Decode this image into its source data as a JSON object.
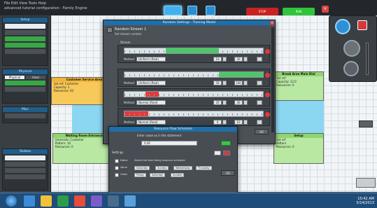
{
  "window": {
    "title_line1": "File  Edit  View  Tools  Help",
    "title_line2": "advanced  tutorial configuration - Family Engine"
  },
  "topbar": {
    "stop_label": "STOP",
    "run_label": "RUN"
  },
  "left_sidebar": {
    "sections": [
      {
        "title": "Setup"
      },
      {
        "title": "Physical"
      },
      {
        "title": "Misc"
      },
      {
        "title": "Toolbox"
      }
    ],
    "physical_tabs": [
      "Physical",
      "Ideal"
    ]
  },
  "canvas": {
    "cards": [
      {
        "title": "Customer Service Area",
        "lines": [
          "Set ref: Customer",
          "Capacity: 1",
          "Resources: 42"
        ]
      },
      {
        "title": "Waiting Room Entrance",
        "lines": [
          "Generate: Customer",
          "Pattern: 10",
          "Resources: 0"
        ]
      },
      {
        "title": "Break Area Main Dial",
        "lines": [
          "Set ref",
          "Capacity: 12.0",
          "Resources: 0"
        ]
      },
      {
        "title": "Setup",
        "lines": [
          "Set ref",
          "Pattern",
          "Resources: 0"
        ]
      }
    ]
  },
  "settings_dialog": {
    "title": "Random Settings - Training Model",
    "heading": "Random Stream 1",
    "subheading": "Set stream number",
    "section_label": "Stream",
    "rows": [
      {
        "mode_label": "Method",
        "mode_value": "Uniform (Real)",
        "min": "10",
        "max": "50",
        "fill_color": "#49c964",
        "fill_start": 0.3,
        "fill_end": 0.68
      },
      {
        "mode_label": "Method",
        "mode_value": "Uniform (Real)",
        "min": "50",
        "max": "100",
        "fill_color": "#49c964",
        "fill_start": 0.68,
        "fill_end": 1.0
      },
      {
        "mode_label": "Method",
        "mode_value": "Normal (Real)",
        "min": "20",
        "max": "30",
        "fill_color": "#e53a3a",
        "fill_start": 0.15,
        "fill_end": 0.25
      },
      {
        "mode_label": "Method",
        "mode_value": "Normal (Real)",
        "min": "0",
        "max": "10",
        "fill_color": "#e53a3a",
        "fill_start": 0.0,
        "fill_end": 0.17
      }
    ],
    "ok_label": "OK"
  },
  "resource_dialog": {
    "title": "Resource Flow Schedule",
    "prompt": "Enter value as in the statement",
    "field_value": "0.00",
    "section_label": "Settings",
    "rows": [
      {
        "label": "Name",
        "text": "Select the item being resource schedule"
      },
      {
        "label": "Value",
        "options": [
          "Saturday",
          "Sunday",
          "Wednesday",
          "Thursday"
        ]
      },
      {
        "label": "Order",
        "options": [
          "Friday",
          "Saturday",
          "Sunday"
        ]
      }
    ],
    "ok_label": "OK"
  },
  "taskbar": {
    "time": "10:42 AM",
    "date": "5/14/2013"
  },
  "colors": {
    "accent": "#1e6ea8",
    "canvas_bg": "#f2f5f7",
    "green_fill": "#49c964",
    "red_fill": "#e53a3a",
    "taskbar": "#1f4c78"
  }
}
